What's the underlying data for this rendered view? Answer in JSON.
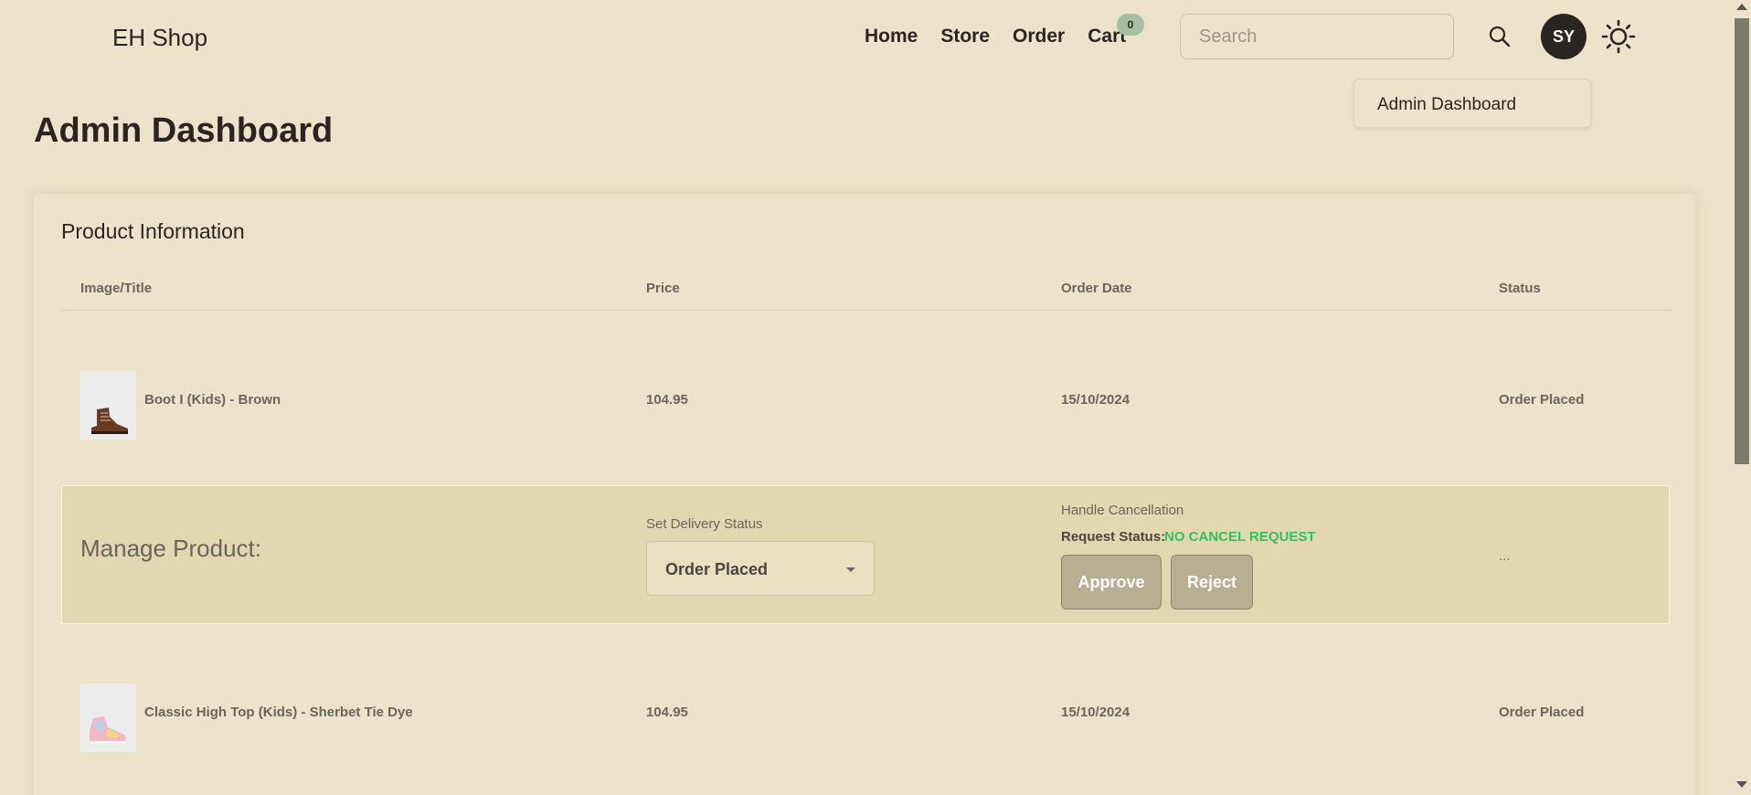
{
  "navbar": {
    "brand": "EH Shop",
    "links": [
      "Home",
      "Store",
      "Order",
      "Cart"
    ],
    "cart_count": "0",
    "search_placeholder": "Search",
    "avatar_initials": "SY",
    "dropdown_item": "Admin Dashboard"
  },
  "page": {
    "title": "Admin Dashboard"
  },
  "card": {
    "title": "Product Information",
    "columns": [
      "Image/Title",
      "Price",
      "Order Date",
      "Status"
    ],
    "rows": [
      {
        "title": "Boot I (Kids) - Brown",
        "price": "104.95",
        "order_date": "15/10/2024",
        "status": "Order Placed"
      },
      {
        "title": "Classic High Top (Kids) - Sherbet Tie Dye",
        "price": "104.95",
        "order_date": "15/10/2024",
        "status": "Order Placed"
      }
    ],
    "manage": {
      "title": "Manage Product:",
      "delivery_label": "Set Delivery Status",
      "delivery_value": "Order Placed",
      "cancel_label": "Handle Cancellation",
      "request_label": "Request Status:",
      "request_value": "NO CANCEL REQUEST",
      "approve": "Approve",
      "reject": "Reject",
      "extra": "..."
    }
  },
  "colors": {
    "background": "#ede3ca",
    "manage_bg": "#e3d7b2",
    "status_green": "#2fc25b",
    "button": "#b8ae92"
  }
}
